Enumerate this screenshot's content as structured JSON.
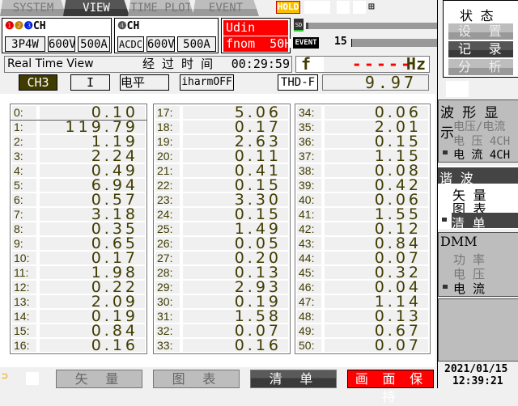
{
  "tabs": [
    {
      "label": "SYSTEM",
      "active": false
    },
    {
      "label": "VIEW",
      "active": true
    },
    {
      "label": "TIME PLOT",
      "active": false
    },
    {
      "label": "EVENT",
      "active": false
    }
  ],
  "hold_label": "HOLD",
  "ch123": {
    "label": "CH",
    "wiring": "3P4W",
    "voltage": "600V",
    "current": "500A"
  },
  "ch4": {
    "label": "CH",
    "coupling": "ACDC",
    "voltage": "600V",
    "current": "500A"
  },
  "udin": "Udin 230V",
  "fnom": "fnom  50Hz",
  "event_label": "EVENT",
  "event_count": "15",
  "status": {
    "mode": "Real Time View",
    "elapsed_label": "经 过 时 间",
    "elapsed": "00:29:59"
  },
  "freq": {
    "label": "f :",
    "value": "-----",
    "unit": "Hz"
  },
  "selectors": {
    "channel": "CH3",
    "quantity": "I",
    "level": "电平",
    "iharm": "iharmOFF"
  },
  "thd": {
    "label": "THD-F",
    "value": "9.97"
  },
  "harmonics": [
    [
      "0:",
      "0.10"
    ],
    [
      "1:",
      "119.79"
    ],
    [
      "2:",
      "1.19"
    ],
    [
      "3:",
      "2.24"
    ],
    [
      "4:",
      "0.49"
    ],
    [
      "5:",
      "6.94"
    ],
    [
      "6:",
      "0.57"
    ],
    [
      "7:",
      "3.18"
    ],
    [
      "8:",
      "0.35"
    ],
    [
      "9:",
      "0.65"
    ],
    [
      "10:",
      "0.17"
    ],
    [
      "11:",
      "1.98"
    ],
    [
      "12:",
      "0.22"
    ],
    [
      "13:",
      "2.09"
    ],
    [
      "14:",
      "0.19"
    ],
    [
      "15:",
      "0.84"
    ],
    [
      "16:",
      "0.16"
    ],
    [
      "17:",
      "5.06"
    ],
    [
      "18:",
      "0.17"
    ],
    [
      "19:",
      "2.63"
    ],
    [
      "20:",
      "0.11"
    ],
    [
      "21:",
      "0.41"
    ],
    [
      "22:",
      "0.15"
    ],
    [
      "23:",
      "3.30"
    ],
    [
      "24:",
      "0.15"
    ],
    [
      "25:",
      "1.49"
    ],
    [
      "26:",
      "0.05"
    ],
    [
      "27:",
      "0.20"
    ],
    [
      "28:",
      "0.13"
    ],
    [
      "29:",
      "2.93"
    ],
    [
      "30:",
      "0.19"
    ],
    [
      "31:",
      "1.58"
    ],
    [
      "32:",
      "0.07"
    ],
    [
      "33:",
      "0.16"
    ],
    [
      "34:",
      "0.06"
    ],
    [
      "35:",
      "2.01"
    ],
    [
      "36:",
      "0.15"
    ],
    [
      "37:",
      "1.15"
    ],
    [
      "38:",
      "0.08"
    ],
    [
      "39:",
      "0.42"
    ],
    [
      "40:",
      "0.06"
    ],
    [
      "41:",
      "1.55"
    ],
    [
      "42:",
      "0.12"
    ],
    [
      "43:",
      "0.84"
    ],
    [
      "44:",
      "0.07"
    ],
    [
      "45:",
      "0.32"
    ],
    [
      "46:",
      "0.04"
    ],
    [
      "47:",
      "1.14"
    ],
    [
      "48:",
      "0.13"
    ],
    [
      "49:",
      "0.67"
    ],
    [
      "50:",
      "0.07"
    ]
  ],
  "side": {
    "status_title": "状 态",
    "setup": "设 置",
    "record": "记 录",
    "analyze": "分 析",
    "waveform_title": "波 形 显 示",
    "wave_items": [
      "电压/电流",
      "电 压 4CH",
      "电 流 4CH"
    ],
    "harmonic_title": "谐 波",
    "harm_items": [
      "矢 量",
      "图 表",
      "清 单"
    ],
    "dmm_title": "DMM",
    "dmm_items": [
      "功 率",
      "电 压",
      "电 流"
    ]
  },
  "footer": {
    "vector": "矢 量",
    "graph": "图 表",
    "list": "清 单",
    "screen_hold": "画 面 保 持",
    "date": "2021/01/15",
    "time": "12:39:21"
  },
  "colors": {
    "value_text": "#403c00",
    "alert": "#ff0000",
    "ch1": "#e00000",
    "ch2": "#c08000",
    "ch3": "#0020e0"
  }
}
